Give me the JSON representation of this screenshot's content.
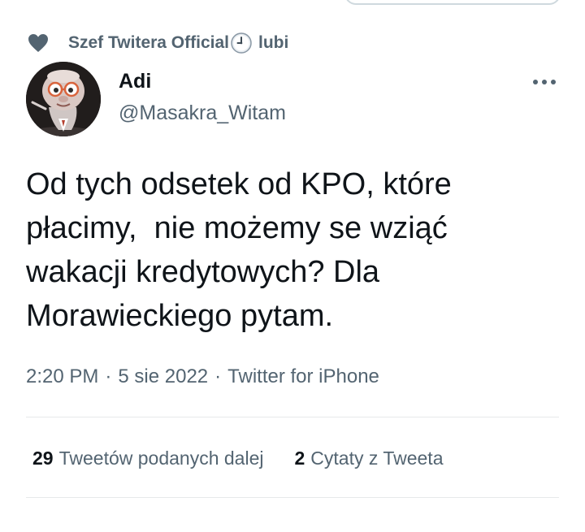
{
  "social_context": {
    "icon": "heart-icon",
    "text_before": "Szef Twitera Official",
    "clock_icon": "clock-icon",
    "text_after": "lubi"
  },
  "author": {
    "display_name": "Adi",
    "handle": "@Masakra_Witam",
    "avatar": "cartoon-character-avatar"
  },
  "tweet": {
    "text": "Od tych odsetek od KPO, które\npłacimy,  nie możemy se wziąć\nwakacji kredytowych? Dla\nMorawieckiego pytam."
  },
  "meta": {
    "time": "2:20 PM",
    "date": "5 sie 2022",
    "source": "Twitter for iPhone",
    "separator": "·"
  },
  "stats": {
    "retweets_count": "29",
    "retweets_label": "Tweetów podanych dalej",
    "quotes_count": "2",
    "quotes_label": "Cytaty z Tweeta"
  },
  "colors": {
    "text": "#0f1419",
    "secondary": "#536471",
    "divider": "#e7e9ea"
  }
}
